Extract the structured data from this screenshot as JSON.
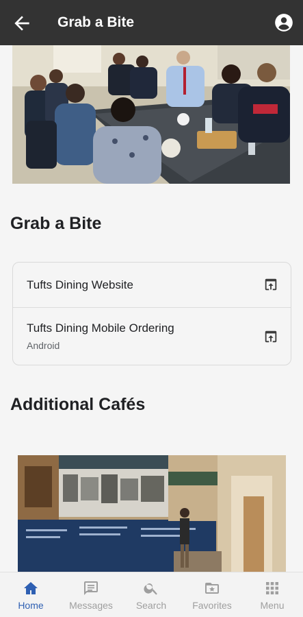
{
  "app_bar": {
    "title": "Grab a Bite"
  },
  "sections": {
    "main_title": "Grab a Bite",
    "additional_title": "Additional Cafés"
  },
  "links": [
    {
      "label": "Tufts Dining Website",
      "subtitle": ""
    },
    {
      "label": "Tufts Dining Mobile Ordering",
      "subtitle": "Android"
    }
  ],
  "bottom_nav": [
    {
      "label": "Home",
      "icon": "home-icon",
      "active": true
    },
    {
      "label": "Messages",
      "icon": "messages-icon",
      "active": false
    },
    {
      "label": "Search",
      "icon": "search-icon",
      "active": false
    },
    {
      "label": "Favorites",
      "icon": "favorites-icon",
      "active": false
    },
    {
      "label": "Menu",
      "icon": "menu-grid-icon",
      "active": false
    }
  ],
  "colors": {
    "app_bar": "#333333",
    "accent": "#2e5fb2",
    "nav_inactive": "#9e9e9e",
    "background": "#f5f5f5"
  }
}
